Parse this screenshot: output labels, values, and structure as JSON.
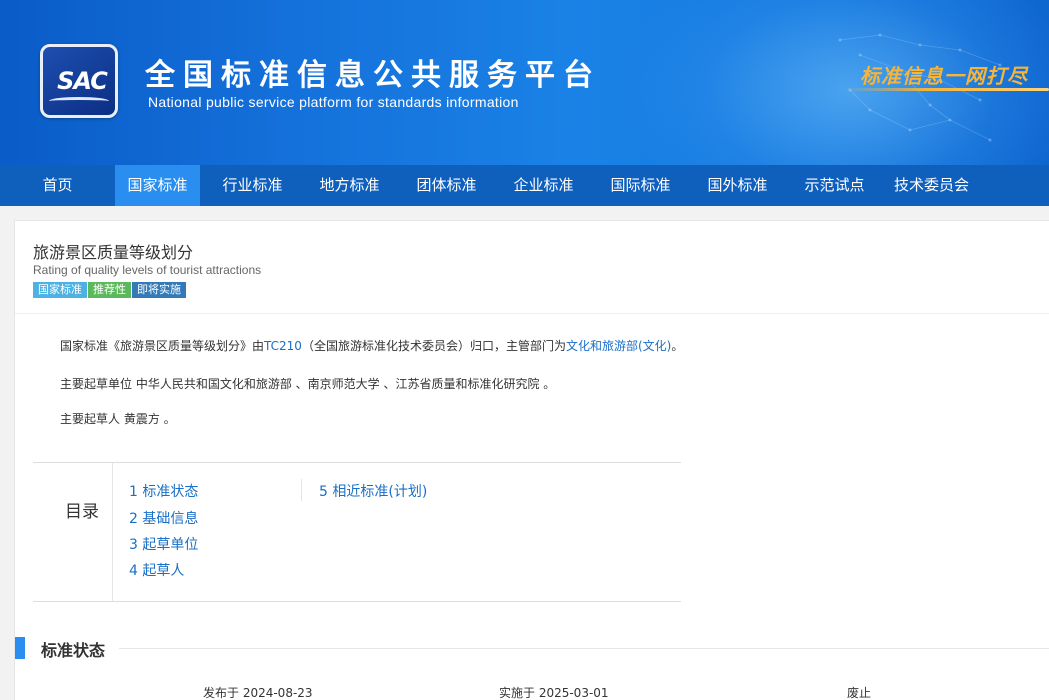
{
  "header": {
    "logo_text": "SAC",
    "title": "全国标准信息公共服务平台",
    "subtitle": "National public service platform  for standards information",
    "slogan": "标准信息一网打尽"
  },
  "nav": {
    "items": [
      {
        "label": "首页",
        "active": false
      },
      {
        "label": "国家标准",
        "active": true
      },
      {
        "label": "行业标准",
        "active": false
      },
      {
        "label": "地方标准",
        "active": false
      },
      {
        "label": "团体标准",
        "active": false
      },
      {
        "label": "企业标准",
        "active": false
      },
      {
        "label": "国际标准",
        "active": false
      },
      {
        "label": "国外标准",
        "active": false
      },
      {
        "label": "示范试点",
        "active": false
      },
      {
        "label": "技术委员会",
        "active": false
      }
    ]
  },
  "standard": {
    "title": "旅游景区质量等级划分",
    "title_en": "Rating of quality levels of tourist attractions",
    "tags": [
      "国家标准",
      "推荐性",
      "即将实施"
    ]
  },
  "intro": {
    "line1_prefix": "国家标准《旅游景区质量等级划分》由",
    "tc_link": "TC210",
    "line1_middle": "（全国旅游标准化技术委员会）归口，主管部门为",
    "dept_link": "文化和旅游部(文化)",
    "line1_suffix": "。",
    "line2": "主要起草单位 中华人民共和国文化和旅游部 、南京师范大学 、江苏省质量和标准化研究院 。",
    "line3": "主要起草人 黄震方 。"
  },
  "toc": {
    "label": "目录",
    "items": [
      "1 标准状态",
      "2 基础信息",
      "3 起草单位",
      "4 起草人",
      "5 相近标准(计划)"
    ]
  },
  "status_section": {
    "title": "标准状态",
    "published": "发布于 2024-08-23",
    "implemented": "实施于 2025-03-01",
    "abolished": "废止"
  },
  "colors": {
    "nav_bg": "#0f5fbd",
    "nav_active": "#2a8ef0",
    "link": "#1a6fc7",
    "tag_national": "#4cb2e4",
    "tag_recommended": "#5cb85c",
    "tag_upcoming": "#337ab7"
  }
}
